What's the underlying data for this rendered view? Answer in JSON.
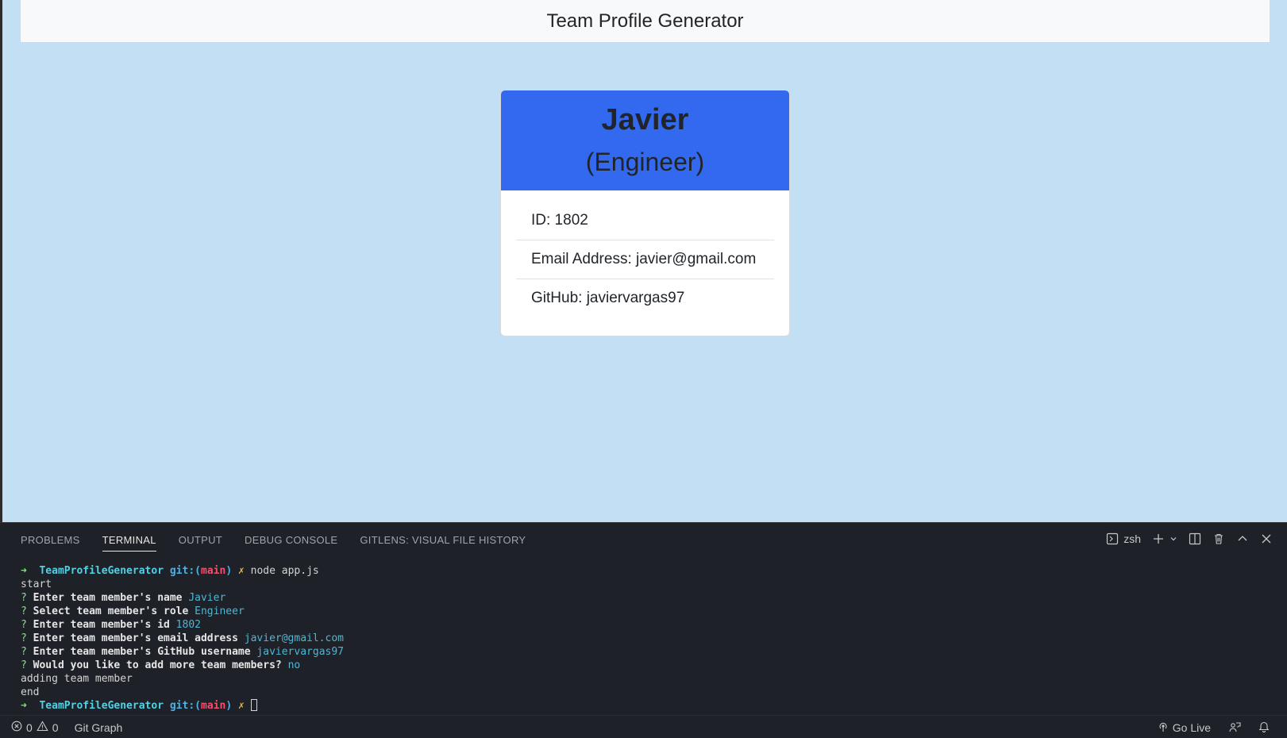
{
  "preview": {
    "navbar_title": "Team Profile Generator",
    "card": {
      "name": "Javier",
      "role": "(Engineer)",
      "id_line": "ID: 1802",
      "email_line": "Email Address: javier@gmail.com",
      "github_line": "GitHub: javiervargas97"
    },
    "colors": {
      "background": "#c3dff3",
      "card_header": "#3269ef"
    }
  },
  "panel": {
    "tabs": [
      {
        "label": "PROBLEMS",
        "active": false
      },
      {
        "label": "TERMINAL",
        "active": true
      },
      {
        "label": "OUTPUT",
        "active": false
      },
      {
        "label": "DEBUG CONSOLE",
        "active": false
      },
      {
        "label": "GITLENS: VISUAL FILE HISTORY",
        "active": false
      }
    ],
    "shell_label": "zsh",
    "actions": [
      "terminal-icon",
      "plus-icon",
      "chevron-down-icon",
      "split-icon",
      "trash-icon",
      "chevron-up-icon",
      "close-icon"
    ]
  },
  "terminal": {
    "prompt_dir": "TeamProfileGenerator",
    "prompt_git": "git:(",
    "prompt_branch": "main",
    "prompt_git_close": ")",
    "command": "node app.js",
    "lines": {
      "start": "start",
      "q_name": "Enter team member's name",
      "a_name": "Javier",
      "q_role": "Select team member's role",
      "a_role": "Engineer",
      "q_id": "Enter team member's id",
      "a_id": "1802",
      "q_email": "Enter team member's email address",
      "a_email": "javier@gmail.com",
      "q_github": "Enter team member's GitHub username",
      "a_github": "javiervargas97",
      "q_more": "Would you like to add more team members?",
      "a_more": "no",
      "adding": "adding team member",
      "end": "end"
    }
  },
  "statusbar": {
    "errors": "0",
    "warnings": "0",
    "git_graph": "Git Graph",
    "go_live": "Go Live"
  }
}
